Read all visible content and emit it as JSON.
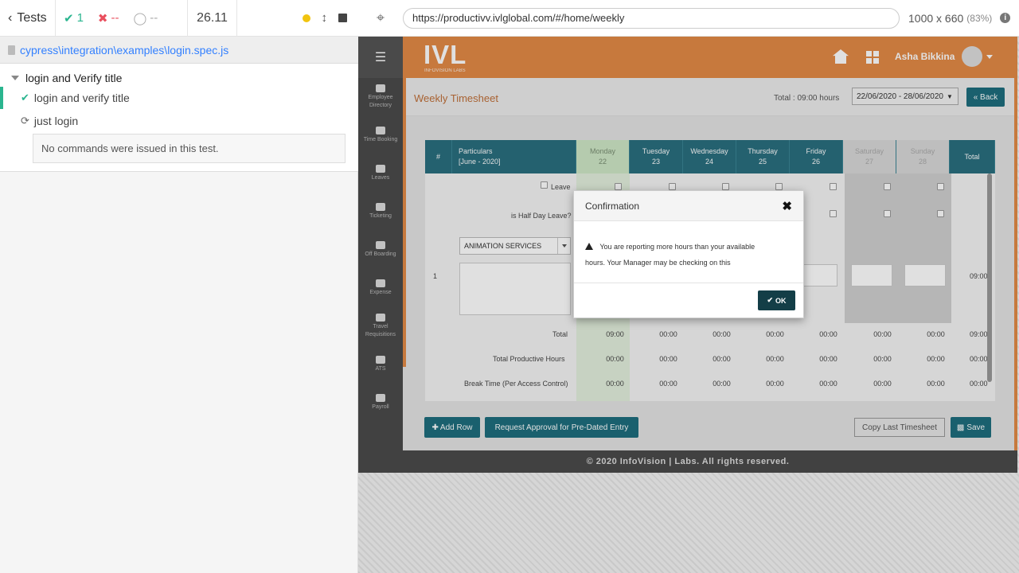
{
  "reporter": {
    "tests_label": "Tests",
    "passed_count": "1",
    "failed_count": "--",
    "pending_count": "--",
    "duration": "26.11",
    "spec_path": "cypress\\integration\\examples\\login.spec.js",
    "suite_title": "login and Verify title",
    "tests": [
      {
        "title": "login and verify title",
        "state": "passed"
      },
      {
        "title": "just login",
        "state": "running"
      }
    ],
    "no_commands_msg": "No commands were issued in this test."
  },
  "aut": {
    "url": "https://productivv.ivlglobal.com/#/home/weekly",
    "viewport": "1000 x 660",
    "scale": "(83%)"
  },
  "app": {
    "logo": "IVL",
    "logo_sub": "INFOVISION LABS",
    "user_name": "Asha Bikkina",
    "sidebar": [
      {
        "label": "Employee Directory"
      },
      {
        "label": "Time Booking"
      },
      {
        "label": "Leaves"
      },
      {
        "label": "Ticketing"
      },
      {
        "label": "Off Boarding"
      },
      {
        "label": "Expense"
      },
      {
        "label": "Travel Requisitions"
      },
      {
        "label": "ATS"
      },
      {
        "label": "Payroll"
      }
    ],
    "page_title": "Weekly Timesheet",
    "total_hours": "Total : 09:00 hours",
    "date_range": "22/06/2020 - 28/06/2020",
    "back_label": "« Back",
    "grid": {
      "hash": "#",
      "particulars": "Particulars",
      "period": "[June - 2020]",
      "days": [
        {
          "name": "Monday",
          "num": "22"
        },
        {
          "name": "Tuesday",
          "num": "23"
        },
        {
          "name": "Wednesday",
          "num": "24"
        },
        {
          "name": "Thursday",
          "num": "25"
        },
        {
          "name": "Friday",
          "num": "26"
        },
        {
          "name": "Saturday",
          "num": "27"
        },
        {
          "name": "Sunday",
          "num": "28"
        }
      ],
      "total_header": "Total",
      "leave_label": "Leave",
      "half_day_label": "is Half Day Leave?",
      "row_num": "1",
      "service": "ANIMATION SERVICES",
      "row_total": "09:00",
      "totals": [
        {
          "label": "Total",
          "values": [
            "09:00",
            "00:00",
            "00:00",
            "00:00",
            "00:00",
            "00:00",
            "00:00"
          ],
          "total": "09:00"
        },
        {
          "label": "Total Productive Hours",
          "values": [
            "00:00",
            "00:00",
            "00:00",
            "00:00",
            "00:00",
            "00:00",
            "00:00"
          ],
          "total": "00:00"
        },
        {
          "label": "Break Time (Per Access Control)",
          "values": [
            "00:00",
            "00:00",
            "00:00",
            "00:00",
            "00:00",
            "00:00",
            "00:00"
          ],
          "total": "00:00"
        }
      ]
    },
    "buttons": {
      "add_row": "Add Row",
      "request_approval": "Request Approval for Pre-Dated Entry",
      "copy_last": "Copy Last Timesheet",
      "save": "Save"
    },
    "footer": "© 2020 InfoVision | Labs. All rights reserved."
  },
  "modal": {
    "title": "Confirmation",
    "message_line1": "You are reporting more hours than your available",
    "message_line2": "hours. Your Manager may be checking on this",
    "ok_label": "OK"
  }
}
